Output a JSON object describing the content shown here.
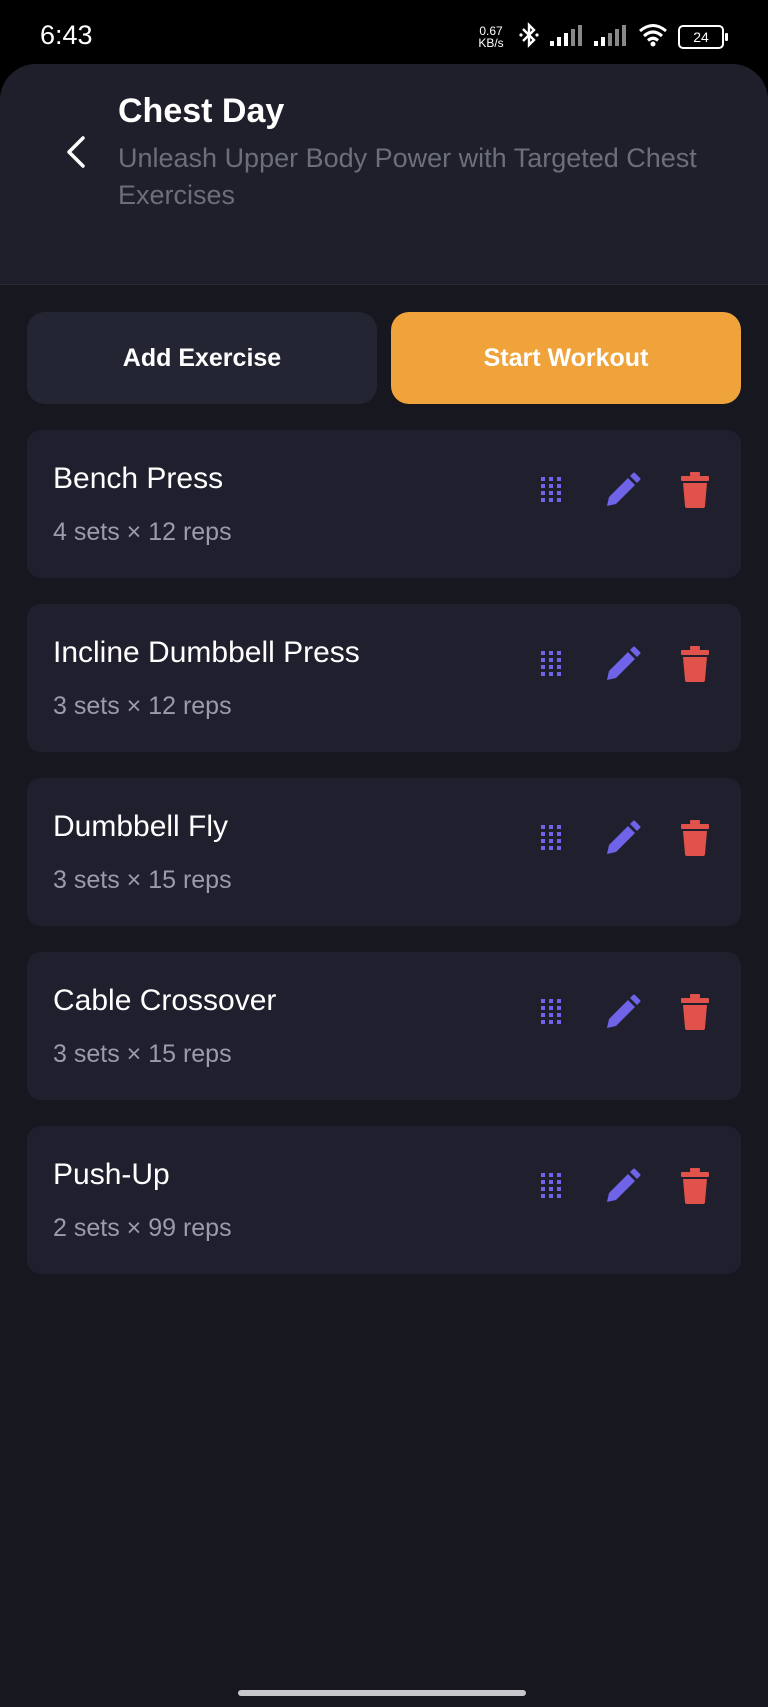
{
  "status": {
    "time": "6:43",
    "net_speed_value": "0.67",
    "net_speed_unit": "KB/s",
    "battery": "24"
  },
  "header": {
    "title": "Chest Day",
    "subtitle": "Unleash Upper Body Power with Targeted Chest Exercises"
  },
  "actions": {
    "add_label": "Add Exercise",
    "start_label": "Start Workout"
  },
  "colors": {
    "accent": "#f0a33b",
    "edit_icon": "#6f63e8",
    "delete_icon": "#e0524a",
    "drag_icon": "#6f63e8"
  },
  "exercises": [
    {
      "name": "Bench Press",
      "detail": "4 sets × 12 reps"
    },
    {
      "name": "Incline Dumbbell Press",
      "detail": "3 sets × 12 reps"
    },
    {
      "name": "Dumbbell Fly",
      "detail": "3 sets × 15 reps"
    },
    {
      "name": "Cable Crossover",
      "detail": "3 sets × 15 reps"
    },
    {
      "name": "Push-Up",
      "detail": "2 sets × 99 reps"
    }
  ]
}
